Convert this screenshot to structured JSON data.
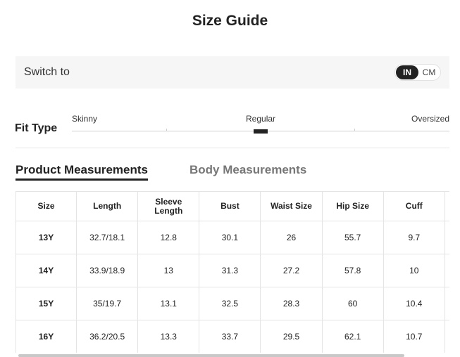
{
  "page": {
    "title": "Size Guide"
  },
  "unit_switch": {
    "label": "Switch to",
    "options": [
      "IN",
      "CM"
    ],
    "selected": "IN"
  },
  "fit_type": {
    "label": "Fit Type",
    "options": [
      "Skinny",
      "Regular",
      "Oversized"
    ],
    "selected": "Regular"
  },
  "tabs": [
    {
      "label": "Product Measurements",
      "active": true
    },
    {
      "label": "Body Measurements",
      "active": false
    }
  ],
  "table": {
    "headers": [
      "Size",
      "Length",
      "Sleeve\nLength",
      "Bust",
      "Waist Size",
      "Hip Size",
      "Cuff",
      ""
    ],
    "rows": [
      [
        "13Y",
        "32.7/18.1",
        "12.8",
        "30.1",
        "26",
        "55.7",
        "9.7",
        ""
      ],
      [
        "14Y",
        "33.9/18.9",
        "13",
        "31.3",
        "27.2",
        "57.8",
        "10",
        ""
      ],
      [
        "15Y",
        "35/19.7",
        "13.1",
        "32.5",
        "28.3",
        "60",
        "10.4",
        ""
      ],
      [
        "16Y",
        "36.2/20.5",
        "13.3",
        "33.7",
        "29.5",
        "62.1",
        "10.7",
        ""
      ]
    ]
  },
  "colors": {
    "active": "#222222",
    "inactive_tab": "#777777",
    "panel_bg": "#f6f6f6"
  }
}
